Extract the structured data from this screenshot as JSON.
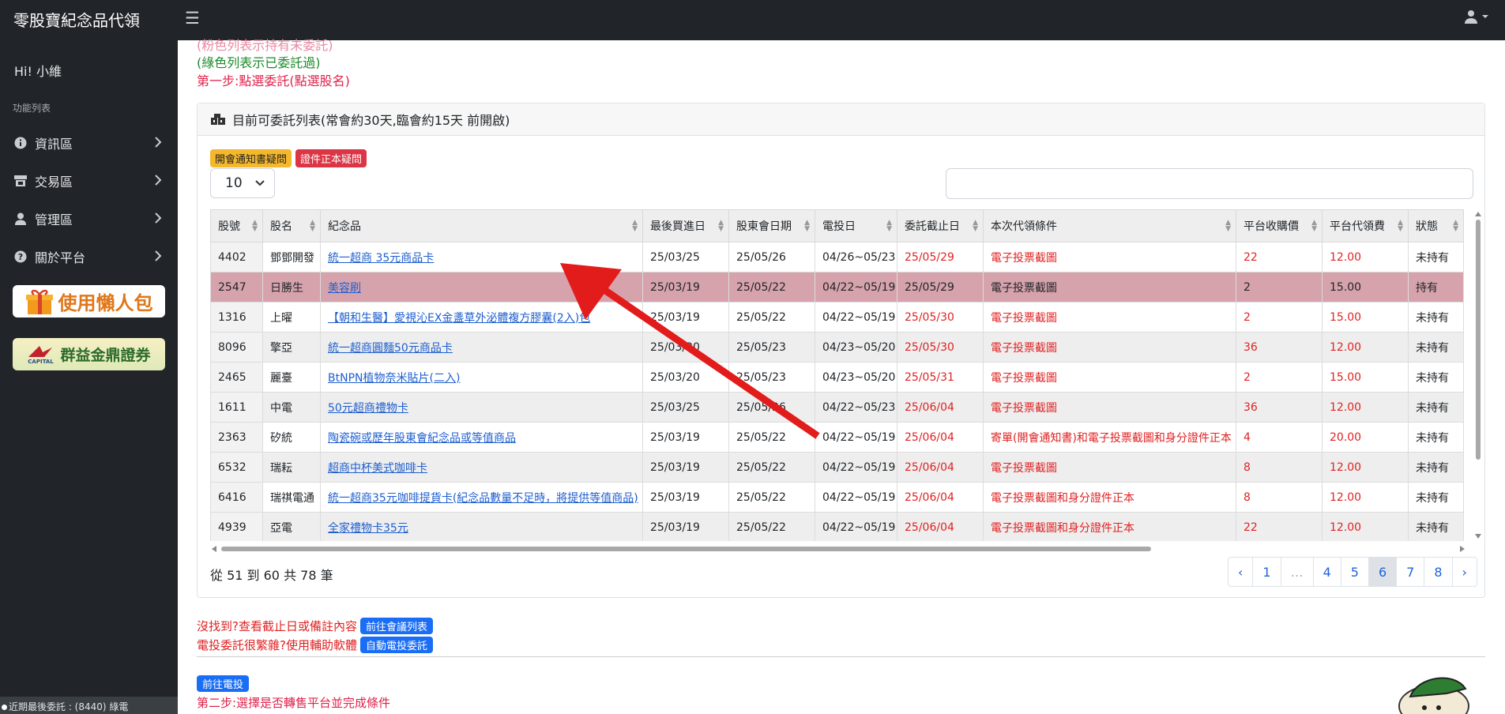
{
  "topbar": {
    "brand": "零股寶紀念品代領"
  },
  "sidebar": {
    "greeting": "Hi! 小維",
    "section": "功能列表",
    "items": [
      {
        "label": "資訊區",
        "icon": "info-icon"
      },
      {
        "label": "交易區",
        "icon": "store-icon"
      },
      {
        "label": "管理區",
        "icon": "user-icon"
      },
      {
        "label": "關於平台",
        "icon": "question-icon"
      }
    ],
    "banner1": "使用懶人包",
    "banner2": "群益金鼎證券",
    "banner2_small": "CAPITAL",
    "footer": "近期最後委託 : (8440) 綠電"
  },
  "content": {
    "note_top": "(粉色列表示持有未委託)",
    "note_green": "(綠色列表示已委託過)",
    "step1": "第一步:點選委託(點選股名)",
    "card_title": "目前可委託列表(常會約30天,臨會約15天 前開啟)",
    "badge1": "開會通知書疑問",
    "badge2": "證件正本疑問",
    "page_size": "10",
    "headers": [
      "股號",
      "股名",
      "紀念品",
      "最後買進日",
      "股東會日期",
      "電投日",
      "委託截止日",
      "本次代領條件",
      "平台收購價",
      "平台代領費",
      "狀態"
    ],
    "rows": [
      [
        "4402",
        "鄧鄧開發",
        "統一超商 35元商品卡",
        "25/03/25",
        "25/05/26",
        "04/26~05/23",
        "25/05/29",
        "電子投票截圖",
        "22",
        "12.00",
        "未持有"
      ],
      [
        "2547",
        "日勝生",
        "美容刷",
        "25/03/19",
        "25/05/22",
        "04/22~05/19",
        "25/05/29",
        "電子投票截圖",
        "2",
        "15.00",
        "持有"
      ],
      [
        "1316",
        "上曜",
        "【朝和生醫】愛視沁EX金盞草外泌體複方膠囊(2入)包",
        "25/03/19",
        "25/05/22",
        "04/22~05/19",
        "25/05/30",
        "電子投票截圖",
        "2",
        "15.00",
        "未持有"
      ],
      [
        "8096",
        "擎亞",
        "統一超商圓麵50元商品卡",
        "25/03/20",
        "25/05/23",
        "04/23~05/20",
        "25/05/30",
        "電子投票截圖",
        "36",
        "12.00",
        "未持有"
      ],
      [
        "2465",
        "麗臺",
        "BtNPN植物奈米貼片(二入)",
        "25/03/20",
        "25/05/23",
        "04/23~05/20",
        "25/05/31",
        "電子投票截圖",
        "2",
        "15.00",
        "未持有"
      ],
      [
        "1611",
        "中電",
        "50元超商禮物卡",
        "25/03/25",
        "25/05/26",
        "04/22~05/23",
        "25/06/04",
        "電子投票截圖",
        "36",
        "12.00",
        "未持有"
      ],
      [
        "2363",
        "矽統",
        "陶瓷碗或歷年股東會紀念品或等值商品",
        "25/03/19",
        "25/05/22",
        "04/22~05/19",
        "25/06/04",
        "寄單(開會通知書)和電子投票截圖和身分證件正本",
        "4",
        "20.00",
        "未持有"
      ],
      [
        "6532",
        "瑞耘",
        "超商中杯美式咖啡卡",
        "25/03/19",
        "25/05/22",
        "04/22~05/19",
        "25/06/04",
        "電子投票截圖",
        "8",
        "12.00",
        "未持有"
      ],
      [
        "6416",
        "瑞祺電通",
        "統一超商35元咖啡提貨卡(紀念品數量不足時，將提供等值商品)",
        "25/03/19",
        "25/05/22",
        "04/22~05/19",
        "25/06/04",
        "電子投票截圖和身分證件正本",
        "8",
        "12.00",
        "未持有"
      ],
      [
        "4939",
        "亞電",
        "全家禮物卡35元",
        "25/03/19",
        "25/05/22",
        "04/22~05/19",
        "25/06/04",
        "電子投票截圖和身分證件正本",
        "22",
        "12.00",
        "未持有"
      ]
    ],
    "info": "從 51 到 60 共 78 筆",
    "pages": [
      "‹",
      "1",
      "…",
      "4",
      "5",
      "6",
      "7",
      "8",
      "›"
    ],
    "not_found": "沒找到?查看截止日或備註內容",
    "btn_meeting": "前往會議列表",
    "hard": "電投委託很繁雜?使用輔助軟體",
    "btn_auto": "自動電投委託",
    "btn_evote": "前往電投",
    "step2": "第二步:選擇是否轉售平台並完成條件"
  }
}
